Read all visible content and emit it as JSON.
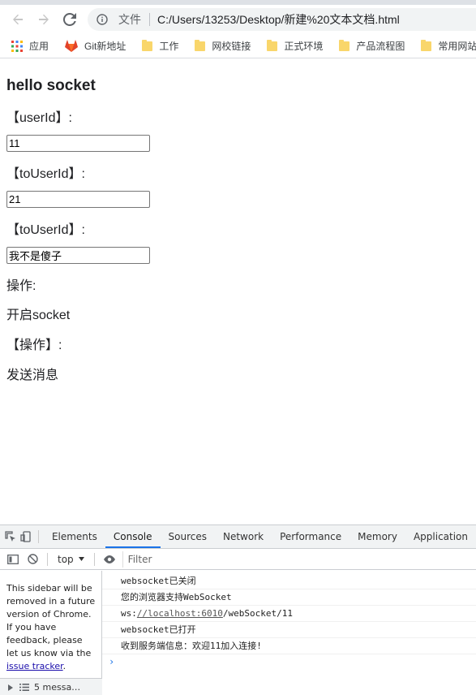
{
  "browser": {
    "url_scheme": "文件",
    "url": "C:/Users/13253/Desktop/新建%20文本文档.html",
    "bookmarks": [
      {
        "label": "应用",
        "icon": "apps-grid-icon"
      },
      {
        "label": "Git新地址",
        "icon": "gitlab-icon"
      },
      {
        "label": "工作",
        "icon": "folder-icon"
      },
      {
        "label": "网校链接",
        "icon": "folder-icon"
      },
      {
        "label": "正式环境",
        "icon": "folder-icon"
      },
      {
        "label": "产品流程图",
        "icon": "folder-icon"
      },
      {
        "label": "常用网站",
        "icon": "folder-icon"
      }
    ]
  },
  "page": {
    "heading": "hello socket",
    "user_id_label": "【userId】:",
    "user_id_value": "11",
    "to_user_id_label": "【toUserId】:",
    "to_user_id_value": "21",
    "content_label": "【toUserId】:",
    "content_value": "我不是傻子",
    "operation_label": "操作:",
    "open_socket": "开启socket",
    "operation_label2": "【操作】:",
    "send_message": "发送消息"
  },
  "devtools": {
    "tabs": [
      "Elements",
      "Console",
      "Sources",
      "Network",
      "Performance",
      "Memory",
      "Application"
    ],
    "active_tab": "Console",
    "context": "top",
    "filter_placeholder": "Filter",
    "sidebar_message_pre": "This sidebar will be removed in a future version of Chrome. If you have feedback, please let us know via the ",
    "sidebar_link": "issue tracker",
    "sidebar_message_post": ".",
    "messages_count": "5 messa…",
    "console_lines": [
      "websocket已关闭",
      "您的浏览器支持WebSocket",
      "ws://localhost:6010/webSocket/11",
      "websocket已打开",
      "收到服务端信息：欢迎11加入连接!"
    ],
    "ws_prefix": "ws:",
    "ws_link": "//localhost:6010",
    "ws_suffix": "/webSocket/11"
  },
  "colors": {
    "accent": "#1a73e8",
    "folder": "#f9d66b"
  }
}
